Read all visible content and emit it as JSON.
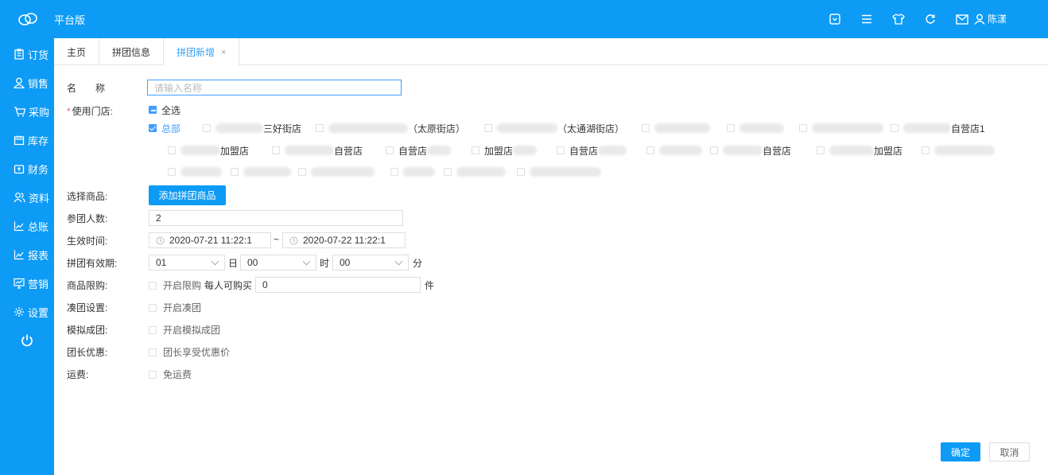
{
  "app": {
    "title": "平台版",
    "user": "陈漾"
  },
  "sidebar": {
    "items": [
      {
        "label": "订货",
        "icon": "clipboard-icon"
      },
      {
        "label": "销售",
        "icon": "person-icon"
      },
      {
        "label": "采购",
        "icon": "cart-icon"
      },
      {
        "label": "库存",
        "icon": "box-icon"
      },
      {
        "label": "财务",
        "icon": "wallet-icon"
      },
      {
        "label": "资料",
        "icon": "users-icon"
      },
      {
        "label": "总账",
        "icon": "chart-icon"
      },
      {
        "label": "报表",
        "icon": "chart-icon"
      },
      {
        "label": "营销",
        "icon": "monitor-icon"
      },
      {
        "label": "设置",
        "icon": "gear-icon"
      }
    ]
  },
  "tabs": [
    {
      "label": "主页"
    },
    {
      "label": "拼团信息"
    },
    {
      "label": "拼团新增",
      "close": "×"
    }
  ],
  "form": {
    "name_label": "名　　称",
    "name_placeholder": "请输入名称",
    "stores_label": "使用门店:",
    "select_all": "全选",
    "hq": "总部",
    "store_suffixes": {
      "s1": "三好街店",
      "s2": "（太原街店）",
      "s3": "（太通湖街店）",
      "s4": "自营店1",
      "s5": "加盟店",
      "s6": "自营店",
      "s7": "自营店",
      "s8": "加盟店",
      "s9": "自营店",
      "s10": "自营店",
      "s11": "加盟店"
    },
    "goods_label": "选择商品:",
    "add_goods_button": "添加拼团商品",
    "people_label": "参团人数:",
    "people_value": "2",
    "time_label": "生效时间:",
    "start_time": "2020-07-21 11:22:1",
    "end_time": "2020-07-22 11:22:1",
    "range_sep": "~",
    "validity_label": "拼团有效期:",
    "day_value": "01",
    "day_unit": "日",
    "hour_value": "00",
    "hour_unit": "时",
    "minute_value": "00",
    "minute_unit": "分",
    "limit_label": "商品限购:",
    "limit_text": "开启限购",
    "per_person_text": "每人可购买",
    "limit_value": "0",
    "limit_unit": "件",
    "gather_label": "凑团设置:",
    "gather_text": "开启凑团",
    "simulate_label": "模拟成团:",
    "simulate_text": "开启模拟成团",
    "leader_label": "团长优惠:",
    "leader_text": "团长享受优惠价",
    "freight_label": "运费:",
    "freight_text": "免运费"
  },
  "actions": {
    "confirm": "确定",
    "cancel": "取消"
  },
  "colors": {
    "brand": "#0d9bf5",
    "link": "#409eff"
  }
}
